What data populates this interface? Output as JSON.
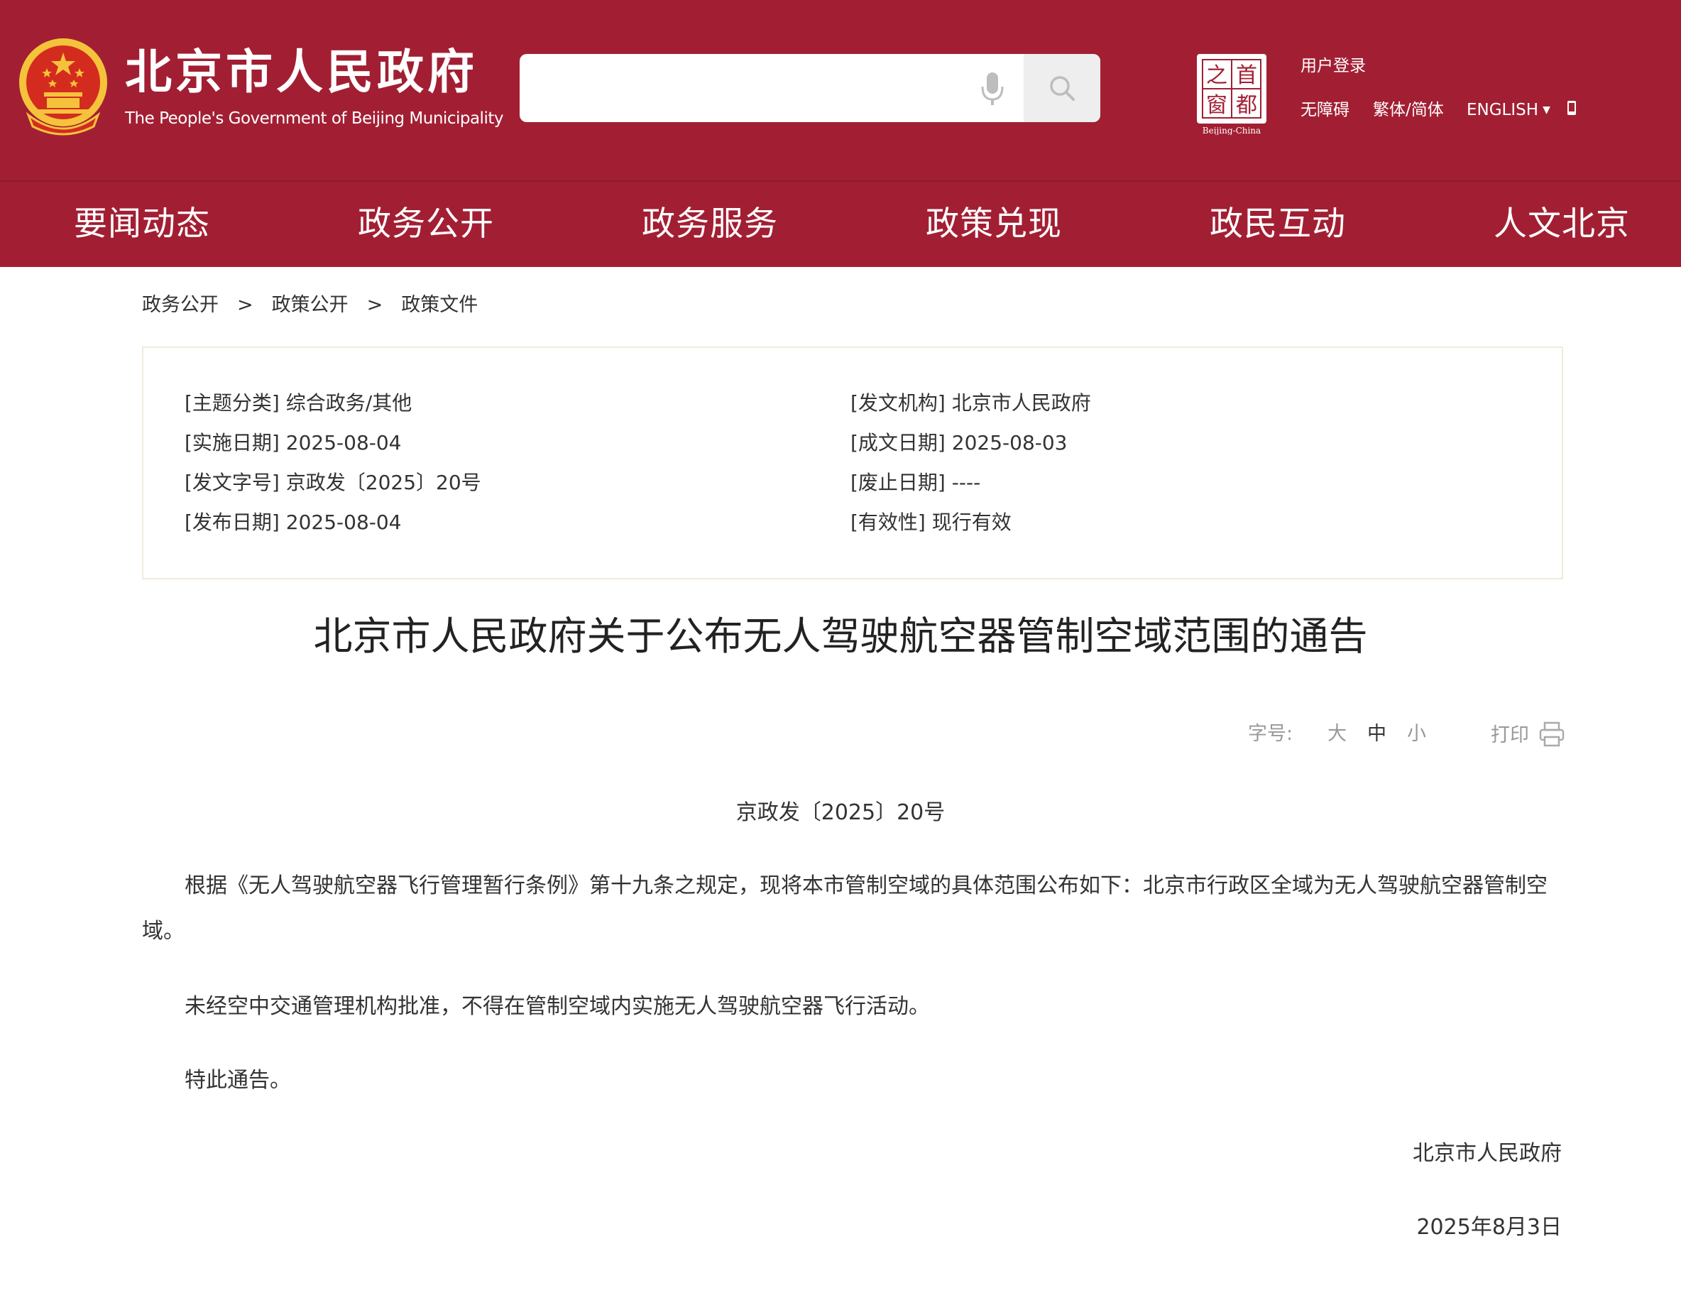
{
  "header": {
    "site_title": "北京市人民政府",
    "site_subtitle": "The People's Government of Beijing Municipality",
    "search": {
      "placeholder": ""
    },
    "capital_logo": {
      "chars": [
        "之",
        "首",
        "窗",
        "都"
      ],
      "caption": "Beijing-China"
    },
    "links": {
      "login": "用户登录",
      "accessibility": "无障碍",
      "traditional_simplified": "繁体/简体",
      "english": "ENGLISH"
    },
    "colors": {
      "brand": "#a21f33",
      "emblem_gold": "#f5c33b"
    }
  },
  "nav": {
    "items": [
      "要闻动态",
      "政务公开",
      "政务服务",
      "政策兑现",
      "政民互动",
      "人文北京"
    ]
  },
  "breadcrumb": {
    "items": [
      "政务公开",
      "政策公开",
      "政策文件"
    ],
    "separator": ">"
  },
  "doc_info": {
    "left": [
      {
        "label": "[主题分类]",
        "value": "综合政务/其他"
      },
      {
        "label": "[实施日期]",
        "value": "2025-08-04"
      },
      {
        "label": "[发文字号]",
        "value": "京政发〔2025〕20号"
      },
      {
        "label": "[发布日期]",
        "value": "2025-08-04"
      }
    ],
    "right": [
      {
        "label": "[发文机构]",
        "value": "北京市人民政府"
      },
      {
        "label": "[成文日期]",
        "value": "2025-08-03"
      },
      {
        "label": "[废止日期]",
        "value": "----"
      },
      {
        "label": "[有效性]",
        "value": "现行有效"
      }
    ]
  },
  "document": {
    "title": "北京市人民政府关于公布无人驾驶航空器管制空域范围的通告",
    "font_size_label": "字号:",
    "font_sizes": {
      "large": "大",
      "medium": "中",
      "small": "小",
      "selected": "中"
    },
    "print_label": "打印",
    "number": "京政发〔2025〕20号",
    "paragraphs": [
      "根据《无人驾驶航空器飞行管理暂行条例》第十九条之规定，现将本市管制空域的具体范围公布如下：北京市行政区全域为无人驾驶航空器管制空域。",
      "未经空中交通管理机构批准，不得在管制空域内实施无人驾驶航空器飞行活动。",
      "特此通告。"
    ],
    "signature": "北京市人民政府",
    "date": "2025年8月3日"
  }
}
